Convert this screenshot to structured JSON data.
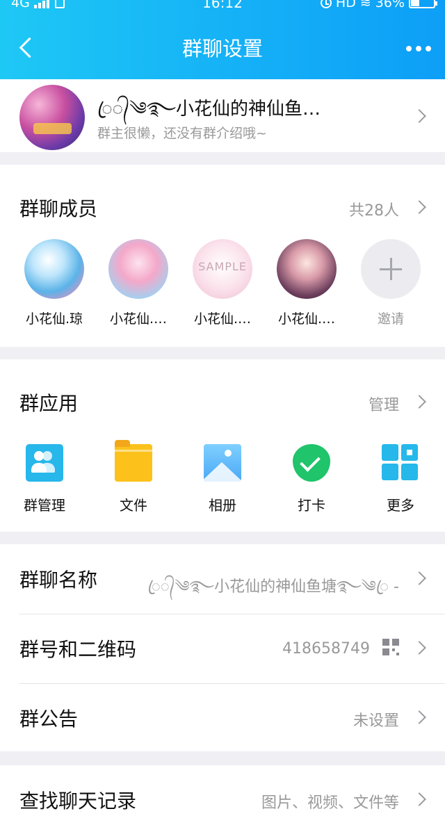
{
  "status_bar": {
    "network": "4G",
    "time": "16:12",
    "hd": "HD",
    "battery": "36%",
    "battery_level": 0.36
  },
  "nav": {
    "title": "群聊设置"
  },
  "group": {
    "name": "ꦿ᭄༄࿐小花仙的神仙鱼…",
    "intro": "群主很懒，还没有群介绍哦~"
  },
  "members": {
    "title": "群聊成员",
    "count": "共28人",
    "list": [
      {
        "name": "小花仙.琼"
      },
      {
        "name": "小花仙.…"
      },
      {
        "name": "小花仙.…"
      },
      {
        "name": "小花仙.…"
      }
    ],
    "invite_label": "邀请",
    "sample_text": "SAMPLE"
  },
  "apps": {
    "title": "群应用",
    "manage": "管理",
    "items": [
      {
        "label": "群管理",
        "icon": "group-manage-icon"
      },
      {
        "label": "文件",
        "icon": "folder-icon"
      },
      {
        "label": "相册",
        "icon": "album-icon"
      },
      {
        "label": "打卡",
        "icon": "checkin-icon"
      },
      {
        "label": "更多",
        "icon": "grid-more-icon"
      }
    ]
  },
  "settings": {
    "group_name_label": "群聊名称",
    "group_name_value": "ꦿ᭄༄࿐小花仙的神仙鱼塘࿐༄ꦿ -",
    "group_id_label": "群号和二维码",
    "group_id_value": "418658749",
    "notice_label": "群公告",
    "notice_value": "未设置"
  },
  "history": {
    "label": "查找聊天记录",
    "hint": "图片、视频、文件等"
  }
}
